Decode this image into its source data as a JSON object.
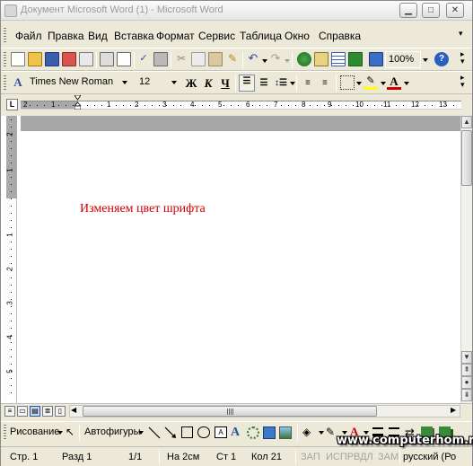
{
  "window": {
    "title": "Документ Microsoft Word (1) - Microsoft Word"
  },
  "menu": {
    "items": [
      "Файл",
      "Правка",
      "Вид",
      "Вставка",
      "Формат",
      "Сервис",
      "Таблица",
      "Окно",
      "Справка"
    ]
  },
  "standard_toolbar": {
    "zoom": "100%",
    "icons": [
      "new-icon",
      "open-icon",
      "save-icon",
      "permission-icon",
      "email-icon",
      "print-icon",
      "print-preview-icon",
      "spelling-icon",
      "research-icon",
      "cut-icon",
      "copy-icon",
      "paste-icon",
      "format-painter-icon",
      "undo-icon",
      "redo-icon",
      "hyperlink-icon",
      "tables-borders-icon",
      "insert-table-icon",
      "insert-excel-icon",
      "columns-icon",
      "drawing-icon",
      "document-map-icon",
      "show-hide-icon",
      "help-icon"
    ]
  },
  "formatting_toolbar": {
    "font_name": "Times New Roman",
    "font_size": "12",
    "bold": "Ж",
    "italic": "К",
    "underline": "Ч",
    "font_color_letter": "A",
    "font_color": "#cc0000",
    "highlight_color": "#ffff00"
  },
  "ruler": {
    "corner": "L",
    "numbers": [
      "2",
      "1",
      "1",
      "2",
      "3",
      "4",
      "5",
      "6",
      "7",
      "8",
      "9",
      "10",
      "11",
      "12",
      "13"
    ]
  },
  "vertical_ruler": {
    "numbers": [
      "2",
      "1",
      "1",
      "2",
      "3",
      "4",
      "5"
    ]
  },
  "document": {
    "text": "Изменяем цвет шрифта",
    "text_color": "#cc0000"
  },
  "drawing_toolbar": {
    "drawing_label": "Рисование",
    "autoshapes_label": "Автофигуры"
  },
  "status_bar": {
    "page": "Стр. 1",
    "section": "Разд 1",
    "page_count": "1/1",
    "at": "На 2см",
    "line": "Ст 1",
    "column": "Кол 21",
    "rec": "ЗАП",
    "trk": "ИСПР",
    "ext": "ВДЛ",
    "ovr": "ЗАМ",
    "language": "русский (Ро"
  },
  "watermark": "www.computerhom.ru"
}
